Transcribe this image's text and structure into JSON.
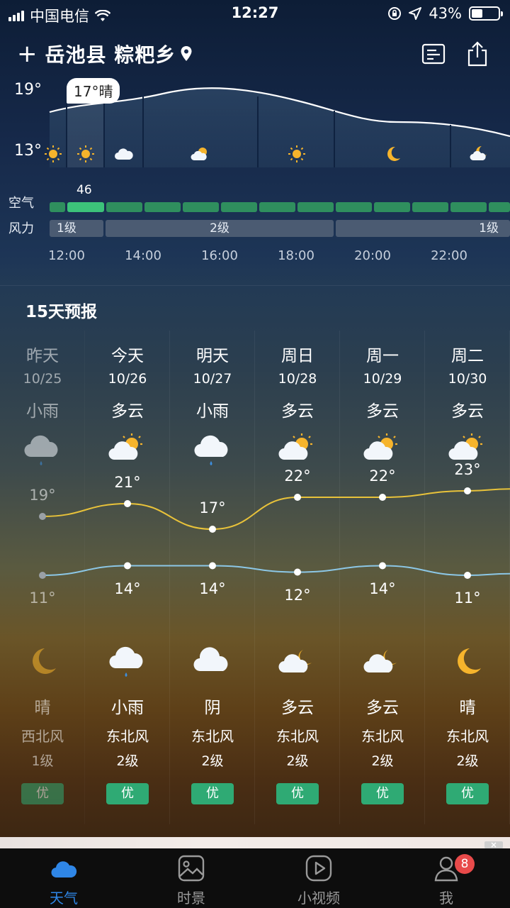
{
  "status_bar": {
    "carrier": "中国电信",
    "time": "12:27",
    "battery": "43%",
    "battery_level": 0.43
  },
  "header": {
    "location": "岳池县 粽粑乡",
    "plus_glyph": "+"
  },
  "hourly": {
    "temp_high_label": "19°",
    "temp_low_label": "13°",
    "current_badge": "17°晴",
    "air_label": "空气",
    "wind_label": "风力",
    "air_value": "46",
    "wind_levels": [
      "1级",
      "2级",
      "1级"
    ],
    "times": [
      "12:00",
      "14:00",
      "16:00",
      "18:00",
      "20:00",
      "22:00"
    ],
    "icons": [
      "sun-icon",
      "sun-icon",
      "cloud-icon",
      "partly-sunny-icon",
      "sun-icon",
      "moon-icon",
      "partly-moon-icon"
    ]
  },
  "forecast": {
    "title": "15天预报",
    "days": [
      {
        "day": "昨天",
        "date": "10/25",
        "cond": "小雨",
        "icon": "rain-icon",
        "high": "19°",
        "high_value": 19,
        "low": "11°",
        "low_value": 11,
        "night_icon": "moon-icon",
        "night_cond": "晴",
        "wind_dir": "西北风",
        "wind_level": "1级",
        "aq": "优"
      },
      {
        "day": "今天",
        "date": "10/26",
        "cond": "多云",
        "icon": "partly-sunny-icon",
        "high": "21°",
        "high_value": 21,
        "low": "14°",
        "low_value": 14,
        "night_icon": "rain-icon",
        "night_cond": "小雨",
        "wind_dir": "东北风",
        "wind_level": "2级",
        "aq": "优"
      },
      {
        "day": "明天",
        "date": "10/27",
        "cond": "小雨",
        "icon": "rain-icon",
        "high": "17°",
        "high_value": 17,
        "low": "14°",
        "low_value": 14,
        "night_icon": "cloud-icon",
        "night_cond": "阴",
        "wind_dir": "东北风",
        "wind_level": "2级",
        "aq": "优"
      },
      {
        "day": "周日",
        "date": "10/28",
        "cond": "多云",
        "icon": "partly-sunny-icon",
        "high": "22°",
        "high_value": 22,
        "low": "12°",
        "low_value": 12,
        "night_icon": "partly-moon-icon",
        "night_cond": "多云",
        "wind_dir": "东北风",
        "wind_level": "2级",
        "aq": "优"
      },
      {
        "day": "周一",
        "date": "10/29",
        "cond": "多云",
        "icon": "partly-sunny-icon",
        "high": "22°",
        "high_value": 22,
        "low": "14°",
        "low_value": 14,
        "night_icon": "partly-moon-icon",
        "night_cond": "多云",
        "wind_dir": "东北风",
        "wind_level": "2级",
        "aq": "优"
      },
      {
        "day": "周二",
        "date": "10/30",
        "cond": "多云",
        "icon": "partly-sunny-icon",
        "high": "23°",
        "high_value": 23,
        "low": "11°",
        "low_value": 11,
        "night_icon": "moon-icon",
        "night_cond": "晴",
        "wind_dir": "东北风",
        "wind_level": "2级",
        "aq": "优"
      }
    ]
  },
  "tabbar": {
    "tabs": [
      {
        "label": "天气",
        "icon": "cloud-icon"
      },
      {
        "label": "时景",
        "icon": "photo-icon"
      },
      {
        "label": "小视频",
        "icon": "play-icon"
      },
      {
        "label": "我",
        "icon": "person-icon",
        "badge": "8"
      }
    ]
  },
  "colors": {
    "accent": "#2f86e6",
    "aq_good": "#2faa74",
    "high_line": "#e8c23a",
    "low_line": "#8cc7e6"
  }
}
